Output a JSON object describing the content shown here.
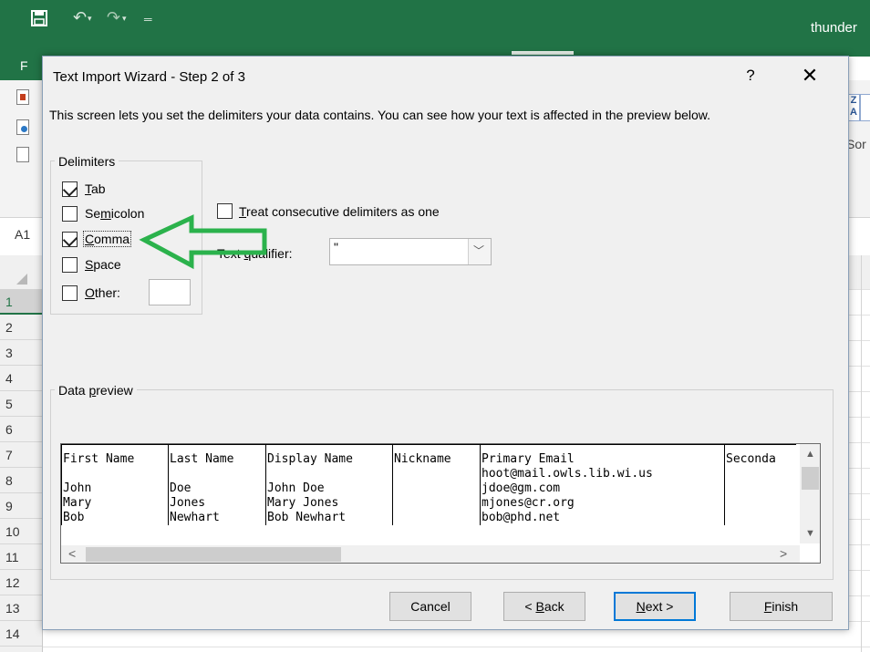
{
  "excel": {
    "window_title": "thunder",
    "file_tab": "F",
    "sort_label": "Sor",
    "sort_glyph": "Z A",
    "name_box": "A1",
    "row_numbers": [
      "1",
      "2",
      "3",
      "4",
      "5",
      "6",
      "7",
      "8",
      "9",
      "10",
      "11",
      "12",
      "13",
      "14"
    ],
    "accent_color": "#217346"
  },
  "dialog": {
    "title": "Text Import Wizard - Step 2 of 3",
    "help_label": "?",
    "close_label": "✕",
    "description": "This screen lets you set the delimiters your data contains.  You can see how your text is affected in the preview below.",
    "delimiters": {
      "group_label": "Delimiters",
      "tab": {
        "pre": "",
        "key": "T",
        "post": "ab",
        "checked": true
      },
      "semicolon": {
        "pre": "Se",
        "key": "m",
        "post": "icolon",
        "checked": false
      },
      "comma": {
        "pre": "",
        "key": "C",
        "post": "omma",
        "checked": true
      },
      "space": {
        "pre": "",
        "key": "S",
        "post": "pace",
        "checked": false
      },
      "other": {
        "pre": "",
        "key": "O",
        "post": "ther:",
        "checked": false,
        "value": ""
      }
    },
    "consecutive": {
      "pre": "",
      "key": "T",
      "post": "reat consecutive delimiters as one",
      "checked": false
    },
    "qualifier": {
      "pre": "Text ",
      "key": "q",
      "post": "ualifier:",
      "value": "\""
    },
    "preview": {
      "group_label_pre": "Data ",
      "group_label_key": "p",
      "group_label_post": "review",
      "rows": [
        [
          "First Name",
          "Last Name",
          "Display Name",
          "Nickname",
          "Primary Email",
          "Seconda"
        ],
        [
          "",
          "",
          "",
          "",
          "hoot@mail.owls.lib.wi.us",
          ""
        ],
        [
          "John",
          "Doe",
          "John Doe",
          "",
          "jdoe@gm.com",
          ""
        ],
        [
          "Mary",
          "Jones",
          "Mary Jones",
          "",
          "mjones@cr.org",
          ""
        ],
        [
          "Bob",
          "Newhart",
          "Bob Newhart",
          "",
          "bob@phd.net",
          ""
        ]
      ]
    },
    "buttons": {
      "cancel": "Cancel",
      "back_pre": "< ",
      "back_key": "B",
      "back_post": "ack",
      "next_pre": "",
      "next_key": "N",
      "next_post": "ext >",
      "finish_pre": "",
      "finish_key": "F",
      "finish_post": "inish"
    },
    "annotation_color": "#2bb24c"
  }
}
